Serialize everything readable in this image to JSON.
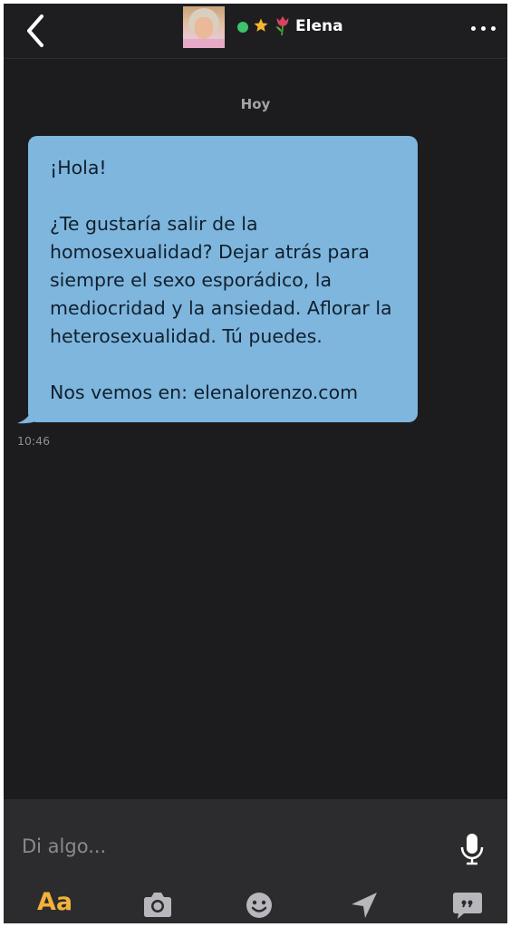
{
  "header": {
    "contact_name": "Elena",
    "online_color": "#3ec36a",
    "icons": [
      "back-chevron-icon",
      "star-icon",
      "tulip-icon",
      "more-dots-icon"
    ]
  },
  "conversation": {
    "date_separator": "Hoy",
    "messages": [
      {
        "paragraphs": [
          "¡Hola!",
          "¿Te gustaría salir de la homosexualidad? Dejar atrás para siempre el sexo esporádico, la mediocridad y la ansiedad. Aflorar la heterosexualidad. Tú puedes.",
          "Nos vemos en: elenalorenzo.com"
        ],
        "time": "10:46",
        "bubble_color": "#7fb6dd"
      }
    ]
  },
  "composer": {
    "placeholder": "Di algo...",
    "toolbar": {
      "text_label": "Aa",
      "accent_color": "#f2b23a",
      "icons": [
        "camera-icon",
        "emoji-icon",
        "location-icon",
        "saved-phrases-icon"
      ]
    }
  }
}
